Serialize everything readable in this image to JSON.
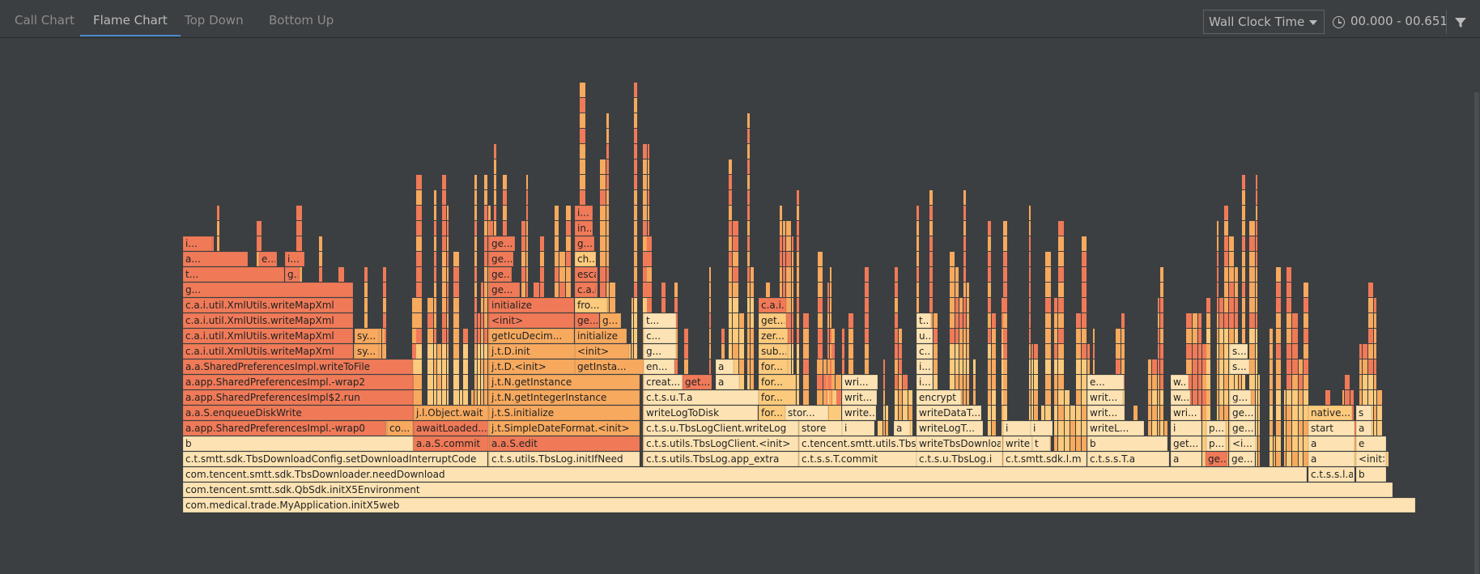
{
  "tabs": [
    {
      "label": "Call Chart",
      "active": false
    },
    {
      "label": "Flame Chart",
      "active": true
    },
    {
      "label": "Top Down",
      "active": false
    },
    {
      "label": "Bottom Up",
      "active": false
    }
  ],
  "clock": {
    "selected": "Wall Clock Time"
  },
  "time_range": "00.000 - 00.651",
  "icons": {
    "clock": "clock-icon",
    "filter": "filter-icon",
    "dropdown": "chevron-down-icon"
  },
  "colors": {
    "background": "#3c3f41",
    "frame_light": "#fde3b3",
    "frame_mid": "#fcca7c",
    "frame_orange": "#f7a95e",
    "frame_red": "#f07a58",
    "accent": "#4a88c7"
  },
  "frames": [
    {
      "label": "com.medical.trade.MyApplication.initX5web",
      "color": "light"
    },
    {
      "label": "com.tencent.smtt.sdk.QbSdk.initX5Environment",
      "color": "light"
    },
    {
      "label": "com.tencent.smtt.sdk.TbsDownloader.needDownload",
      "color": "light"
    },
    {
      "label": "c.t.s.s.l.a",
      "color": "light"
    },
    {
      "label": "b",
      "color": "light"
    },
    {
      "label": "c.t.smtt.sdk.TbsDownloadConfig.setDownloadInterruptCode",
      "color": "light"
    },
    {
      "label": "c.t.s.utils.TbsLog.initIfNeed",
      "color": "light"
    },
    {
      "label": "c.t.s.utils.TbsLog.app_extra",
      "color": "light"
    },
    {
      "label": "c.t.s.s.T.commit",
      "color": "light"
    },
    {
      "label": "c.t.s.u.TbsLog.i",
      "color": "light"
    },
    {
      "label": "c.t.smtt.sdk.l.m",
      "color": "light"
    },
    {
      "label": "c.t.s.s.T.a",
      "color": "light"
    },
    {
      "label": "a",
      "color": "light"
    },
    {
      "label": "ge...",
      "color": "red"
    },
    {
      "label": "ge...",
      "color": "light"
    },
    {
      "label": "a",
      "color": "light"
    },
    {
      "label": "<init>",
      "color": "light"
    },
    {
      "label": "b",
      "color": "light"
    },
    {
      "label": "a.a.S.commit",
      "color": "red"
    },
    {
      "label": "a.a.S.edit",
      "color": "red"
    },
    {
      "label": "c.t.s.utils.TbsLogClient.<init>",
      "color": "light"
    },
    {
      "label": "c.tencent.smtt.utils.TbsLog.i",
      "color": "light"
    },
    {
      "label": "writeTbsDownloadInfo",
      "color": "light"
    },
    {
      "label": "writeLog",
      "color": "light"
    },
    {
      "label": "t",
      "color": "light"
    },
    {
      "label": "b",
      "color": "light"
    },
    {
      "label": "i",
      "color": "light"
    },
    {
      "label": "i",
      "color": "light"
    },
    {
      "label": "get...",
      "color": "light"
    },
    {
      "label": "p...",
      "color": "light"
    },
    {
      "label": "<i...",
      "color": "light"
    },
    {
      "label": "a",
      "color": "light"
    },
    {
      "label": "e",
      "color": "light"
    },
    {
      "label": "a.app.SharedPreferencesImpl.-wrap0",
      "color": "red"
    },
    {
      "label": "co...",
      "color": "orange"
    },
    {
      "label": "awaitLoaded...",
      "color": "red"
    },
    {
      "label": "j.t.SimpleDateFormat.<init>",
      "color": "orange"
    },
    {
      "label": "c.t.s.u.TbsLogClient.writeLog",
      "color": "light"
    },
    {
      "label": "store",
      "color": "light"
    },
    {
      "label": "i",
      "color": "light"
    },
    {
      "label": "a",
      "color": "light"
    },
    {
      "label": "writeLogT...",
      "color": "light"
    },
    {
      "label": "i",
      "color": "light"
    },
    {
      "label": "i",
      "color": "light"
    },
    {
      "label": "writeL...",
      "color": "light"
    },
    {
      "label": "i",
      "color": "light"
    },
    {
      "label": "p...",
      "color": "light"
    },
    {
      "label": "ge...",
      "color": "light"
    },
    {
      "label": "start",
      "color": "light"
    },
    {
      "label": "a",
      "color": "light"
    },
    {
      "label": "a.a.S.enqueueDiskWrite",
      "color": "red"
    },
    {
      "label": "j.l.Object.wait",
      "color": "orange"
    },
    {
      "label": "j.t.S.initialize",
      "color": "orange"
    },
    {
      "label": "writeLogToDisk",
      "color": "light"
    },
    {
      "label": "for...",
      "color": "mid"
    },
    {
      "label": "stor...",
      "color": "light"
    },
    {
      "label": "write...",
      "color": "light"
    },
    {
      "label": "writeDataT...",
      "color": "light"
    },
    {
      "label": "writ...",
      "color": "light"
    },
    {
      "label": "wri...",
      "color": "light"
    },
    {
      "label": "ge...",
      "color": "light"
    },
    {
      "label": "native...",
      "color": "mid"
    },
    {
      "label": "s",
      "color": "light"
    },
    {
      "label": "a.app.SharedPreferencesImpl$2.run",
      "color": "red"
    },
    {
      "label": "j.t.N.getIntegerInstance",
      "color": "orange"
    },
    {
      "label": "c.t.s.u.T.a",
      "color": "light"
    },
    {
      "label": "for...",
      "color": "mid"
    },
    {
      "label": "writ...",
      "color": "light"
    },
    {
      "label": "encrypt",
      "color": "light"
    },
    {
      "label": "writ...",
      "color": "light"
    },
    {
      "label": "w...",
      "color": "light"
    },
    {
      "label": "g...",
      "color": "light"
    },
    {
      "label": "a.app.SharedPreferencesImpl.-wrap2",
      "color": "red"
    },
    {
      "label": "j.t.N.getInstance",
      "color": "orange"
    },
    {
      "label": "creat...",
      "color": "light"
    },
    {
      "label": "get...",
      "color": "red"
    },
    {
      "label": "a",
      "color": "light"
    },
    {
      "label": "for...",
      "color": "mid"
    },
    {
      "label": "wri...",
      "color": "light"
    },
    {
      "label": "i...",
      "color": "light"
    },
    {
      "label": "e...",
      "color": "light"
    },
    {
      "label": "w...",
      "color": "light"
    },
    {
      "label": "a.a.SharedPreferencesImpl.writeToFile",
      "color": "red"
    },
    {
      "label": "j.t.D.<init>",
      "color": "orange"
    },
    {
      "label": "getInsta...",
      "color": "orange"
    },
    {
      "label": "en...",
      "color": "light"
    },
    {
      "label": "a",
      "color": "light"
    },
    {
      "label": "for...",
      "color": "mid"
    },
    {
      "label": "i...",
      "color": "light"
    },
    {
      "label": "s...",
      "color": "light"
    },
    {
      "label": "c.a.i.util.XmlUtils.writeMapXml",
      "color": "red"
    },
    {
      "label": "sy...",
      "color": "orange"
    },
    {
      "label": "j.t.D.init",
      "color": "orange"
    },
    {
      "label": "<init>",
      "color": "orange"
    },
    {
      "label": "g...",
      "color": "light"
    },
    {
      "label": "sub...",
      "color": "mid"
    },
    {
      "label": "c...",
      "color": "light"
    },
    {
      "label": "s...",
      "color": "light"
    },
    {
      "label": "c.a.i.util.XmlUtils.writeMapXml",
      "color": "red"
    },
    {
      "label": "sy...",
      "color": "orange"
    },
    {
      "label": "getIcuDecim...",
      "color": "orange"
    },
    {
      "label": "initialize",
      "color": "orange"
    },
    {
      "label": "c...",
      "color": "light"
    },
    {
      "label": "zer...",
      "color": "mid"
    },
    {
      "label": "u...",
      "color": "light"
    },
    {
      "label": "c.a.i.util.XmlUtils.writeMapXml",
      "color": "red"
    },
    {
      "label": "<init>",
      "color": "red"
    },
    {
      "label": "ge...",
      "color": "red"
    },
    {
      "label": "g...",
      "color": "orange"
    },
    {
      "label": "t...",
      "color": "light"
    },
    {
      "label": "get...",
      "color": "mid"
    },
    {
      "label": "t...",
      "color": "light"
    },
    {
      "label": "c.a.i.util.XmlUtils.writeMapXml",
      "color": "red"
    },
    {
      "label": "initialize",
      "color": "red"
    },
    {
      "label": "fro...",
      "color": "mid"
    },
    {
      "label": "c.a.i.u.XmlUtils.writeValueXml",
      "color": "red"
    },
    {
      "label": "g...",
      "color": "red"
    },
    {
      "label": "ge...",
      "color": "red"
    },
    {
      "label": "c.a.i.u.F.attribute",
      "color": "red"
    },
    {
      "label": "t...",
      "color": "red"
    },
    {
      "label": "g...",
      "color": "red"
    },
    {
      "label": "ge...",
      "color": "red"
    },
    {
      "label": "escapeAndA...",
      "color": "red"
    },
    {
      "label": "a...",
      "color": "red"
    },
    {
      "label": "e...",
      "color": "red"
    },
    {
      "label": "i...",
      "color": "red"
    },
    {
      "label": "ge...",
      "color": "red"
    },
    {
      "label": "ch...",
      "color": "mid"
    },
    {
      "label": "i...",
      "color": "red"
    },
    {
      "label": "ge...",
      "color": "red"
    },
    {
      "label": "g...",
      "color": "red"
    },
    {
      "label": "in...",
      "color": "red"
    },
    {
      "label": "i...",
      "color": "red"
    }
  ]
}
